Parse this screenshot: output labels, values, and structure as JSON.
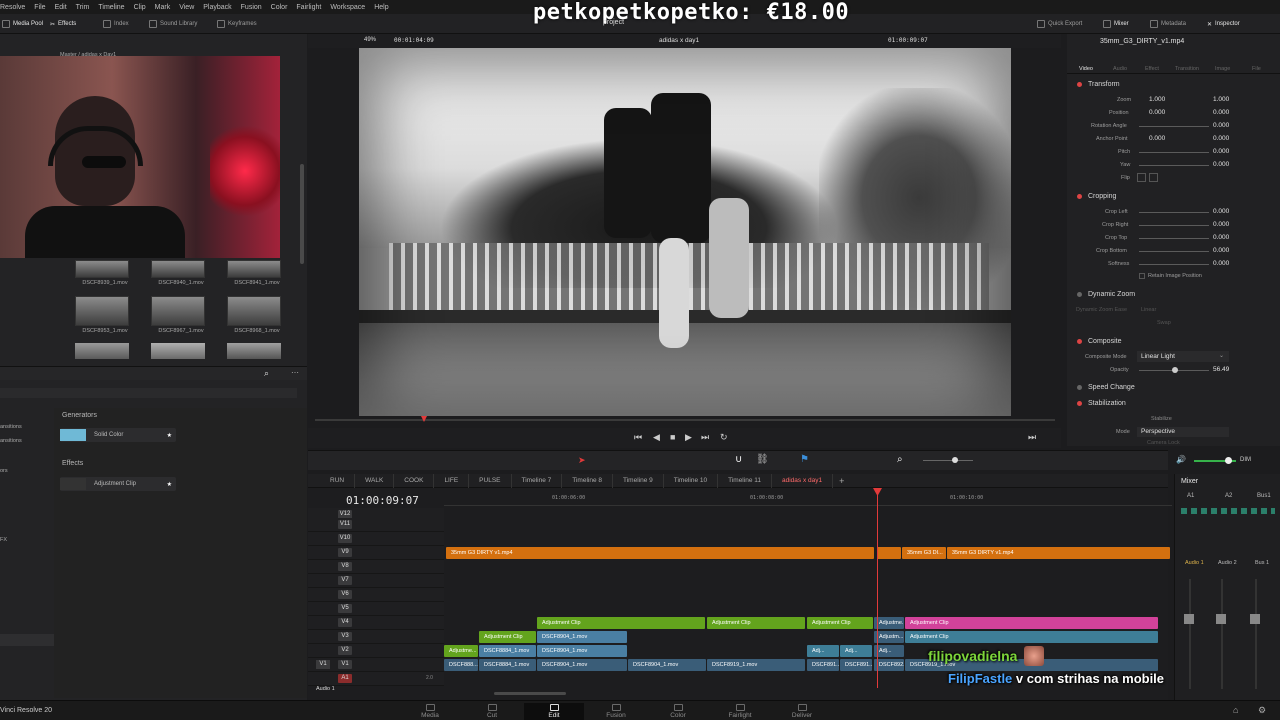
{
  "menu": [
    "Resolve",
    "File",
    "Edit",
    "Trim",
    "Timeline",
    "Clip",
    "Mark",
    "View",
    "Playback",
    "Fusion",
    "Color",
    "Fairlight",
    "Workspace",
    "Help"
  ],
  "toolbar": {
    "media_pool": "Media Pool",
    "effects": "Effects",
    "index": "Index",
    "sound_library": "Sound Library",
    "keyframes": "Keyframes",
    "quick_export": "Quick Export",
    "mixer": "Mixer",
    "metadata": "Metadata",
    "inspector": "Inspector"
  },
  "overlay": {
    "donation": "petkopetkopetko: €18.00",
    "project_label": "project"
  },
  "media": {
    "breadcrumb": "Master / adidas x Day1",
    "clips": [
      {
        "name": "DSCF8939_1.mov"
      },
      {
        "name": "DSCF8940_1.mov"
      },
      {
        "name": "DSCF8941_1.mov"
      },
      {
        "name": "DSCF8953_1.mov"
      },
      {
        "name": "DSCF8967_1.mov"
      },
      {
        "name": "DSCF8968_1.mov"
      }
    ],
    "side_items": [
      "ansitions",
      "ansitions",
      "ors",
      "FX"
    ]
  },
  "effects_panel": {
    "generators_header": "Generators",
    "solid_color": "Solid Color",
    "effects_header": "Effects",
    "adjustment_clip": "Adjustment Clip"
  },
  "viewer": {
    "zoom": "49%",
    "source_timecode": "00:01:04:09",
    "timeline_name": "adidas x day1",
    "record_timecode": "01:00:09:07"
  },
  "inspector": {
    "clip_name": "35mm_G3_DIRTY_v1.mp4",
    "tabs": [
      "Video",
      "Audio",
      "Effect",
      "Transition",
      "Image",
      "File"
    ],
    "transform_title": "Transform",
    "zoom_label": "Zoom",
    "zoom_x": "1.000",
    "zoom_y": "1.000",
    "position_label": "Position",
    "position_x": "0.000",
    "position_y": "0.000",
    "rotation_label": "Rotation Angle",
    "rotation_val": "0.000",
    "anchor_label": "Anchor Point",
    "anchor_x": "0.000",
    "anchor_y": "0.000",
    "pitch_label": "Pitch",
    "pitch_val": "0.000",
    "yaw_label": "Yaw",
    "yaw_val": "0.000",
    "flip_label": "Flip",
    "cropping_title": "Cropping",
    "crop_left_label": "Crop Left",
    "crop_left": "0.000",
    "crop_right_label": "Crop Right",
    "crop_right": "0.000",
    "crop_top_label": "Crop Top",
    "crop_top": "0.000",
    "crop_bottom_label": "Crop Bottom",
    "crop_bottom": "0.000",
    "softness_label": "Softness",
    "softness": "0.000",
    "retain_label": "Retain Image Position",
    "dynamic_zoom_title": "Dynamic Zoom",
    "dz_ease_label": "Dynamic Zoom Ease",
    "dz_ease_val": "Linear",
    "swap_label": "Swap",
    "composite_title": "Composite",
    "composite_mode_label": "Composite Mode",
    "composite_mode": "Linear Light",
    "opacity_label": "Opacity",
    "opacity_val": "56.49",
    "speed_title": "Speed Change",
    "stabilization_title": "Stabilization",
    "stabilize_btn": "Stabilize",
    "mode_label": "Mode",
    "mode_val": "Perspective",
    "camera_lock": "Camera Lock"
  },
  "timeline": {
    "tabs": [
      "RUN",
      "WALK",
      "COOK",
      "LIFE",
      "PULSE",
      "Timeline 7",
      "Timeline 8",
      "Timeline 9",
      "Timeline 10",
      "Timeline 11",
      "adidas x day1"
    ],
    "timecode": "01:00:09:07",
    "ruler": [
      "01:00:06:00",
      "01:00:08:00",
      "01:00:10:00"
    ],
    "tracks": [
      "V12",
      "V11",
      "V10",
      "V9",
      "V8",
      "V7",
      "V6",
      "V5",
      "V4",
      "V3",
      "V2",
      "V1",
      "A1"
    ],
    "v1_patch": "V1",
    "audio_label": "Audio 1",
    "a1_level": "2.0",
    "clips": {
      "v9_a": "35mm G3 DIRTY v1.mp4",
      "v9_b": "35mm G3 DI...",
      "v9_c": "35mm G3 DIRTY v1.mp4",
      "v4_a": "Adjustment Clip",
      "v4_b": "Adjustment Clip",
      "v4_c": "Adjustment Clip",
      "v4_d": "Adjustme...",
      "v4_e": "Adjustment Clip",
      "v3_a": "Adjustment Clip",
      "v3_b": "DSCF8904_1.mov",
      "v3_c": "Adjustm...",
      "v3_d": "Adjustment Clip",
      "v2_a": "Adjustme...",
      "v2_b": "DSCF8884_1.mov",
      "v2_c": "DSCF8904_1.mov",
      "v2_d": "Adj...",
      "v2_e": "Adj...",
      "v2_f": "Adj...",
      "v1_a": "DSCF888...",
      "v1_b": "DSCF8884_1.mov",
      "v1_c": "DSCF8904_1.mov",
      "v1_d": "DSCF8904_1.mov",
      "v1_e": "DSCF8919_1.mov",
      "v1_f": "DSCF891...",
      "v1_g": "DSCF891...",
      "v1_h": "DSCF892...",
      "v1_i": "DSCF8919_1.mov"
    }
  },
  "mixer": {
    "title": "Mixer",
    "channels": [
      "A1",
      "A2",
      "Bus1"
    ],
    "footer": [
      "Audio 1",
      "Audio 2",
      "Bus 1"
    ]
  },
  "audio_bar": {
    "dim": "DIM"
  },
  "pages": [
    "Media",
    "Cut",
    "Edit",
    "Fusion",
    "Color",
    "Fairlight",
    "Deliver"
  ],
  "active_page": "Edit",
  "app_name": "Vinci Resolve 20",
  "chat": {
    "line1": "filipovadielna",
    "line2_name": "FilipFastle",
    "line2_msg": "v com strihas na mobile"
  }
}
